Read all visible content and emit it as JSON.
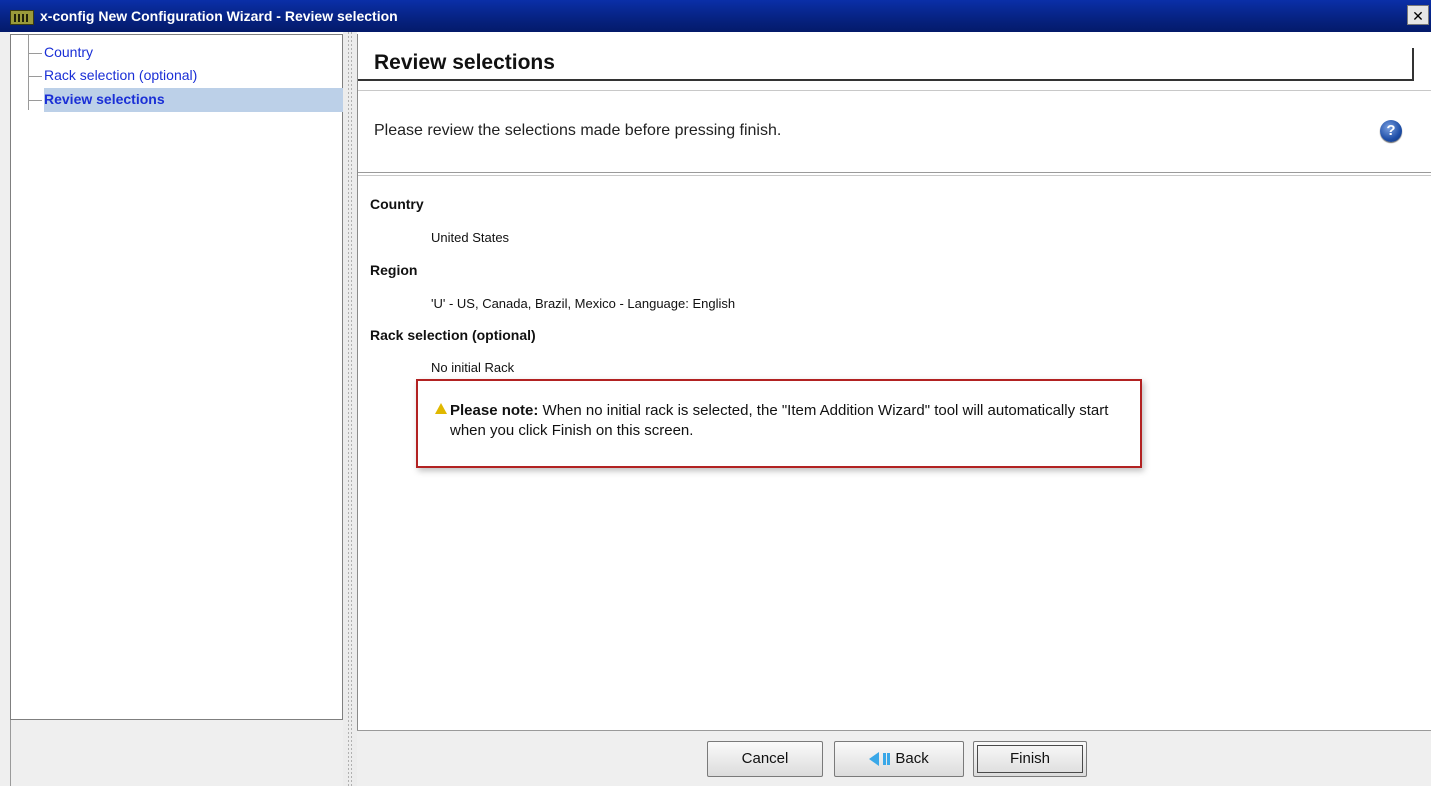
{
  "window": {
    "title": "x-config New Configuration Wizard - Review selection",
    "close_symbol": "✕"
  },
  "nav": {
    "items": [
      {
        "label": "Country",
        "selected": false
      },
      {
        "label": "Rack selection (optional)",
        "selected": false
      },
      {
        "label": "Review selections",
        "selected": true
      }
    ]
  },
  "header": {
    "title": "Review selections",
    "instructions": "Please review the selections made before pressing finish.",
    "help_icon": "help-icon"
  },
  "review": {
    "country_heading": "Country",
    "country_value": "United States",
    "region_heading": "Region",
    "region_value": "'U' - US, Canada, Brazil, Mexico - Language: English",
    "rack_heading": "Rack selection (optional)",
    "rack_value": "No initial Rack"
  },
  "note": {
    "prefix": "Please note:",
    "text": " When no initial rack is selected, the \"Item Addition Wizard\" tool will automatically start when you click Finish on this screen."
  },
  "buttons": {
    "cancel": "Cancel",
    "back": "Back",
    "finish": "Finish"
  },
  "colors": {
    "titlebar": "#062280",
    "nav_link": "#1a2fd6",
    "nav_selected_bg": "#bcd0e8",
    "note_border": "#b22222",
    "warning": "#e0b800",
    "help": "#1f4fa8"
  }
}
